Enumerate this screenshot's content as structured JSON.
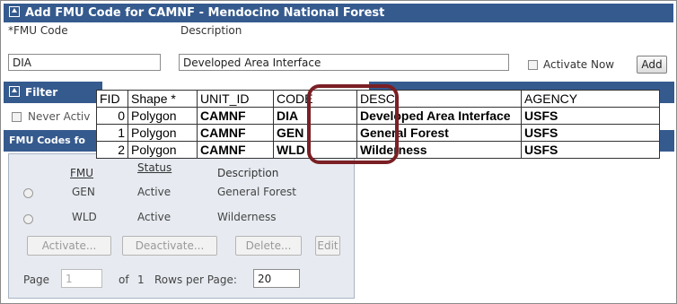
{
  "add_panel": {
    "title": "Add FMU Code for CAMNF - Mendocino National Forest",
    "fmu_code_label": "*FMU Code",
    "fmu_code_value": "DIA",
    "description_label": "Description",
    "description_value": "Developed Area Interface",
    "activate_now_label": "Activate Now",
    "add_label": "Add"
  },
  "filter_panel": {
    "title": "Filter",
    "never_active_label": "Never Activ"
  },
  "codes_panel": {
    "title": "FMU Codes fo",
    "columns": [
      "FMU",
      "Status",
      "Description"
    ],
    "rows": [
      {
        "code": "GEN",
        "status": "Active",
        "description": "General Forest"
      },
      {
        "code": "WLD",
        "status": "Active",
        "description": "Wilderness"
      }
    ],
    "buttons": {
      "activate": "Activate...",
      "deactivate": "Deactivate...",
      "delete": "Delete...",
      "edit": "Edit"
    },
    "pager": {
      "page_label": "Page",
      "page_value": "1",
      "of_label": "of",
      "total_pages": "1",
      "rows_label": "Rows per Page:",
      "rows_value": "20"
    }
  },
  "attribute_table": {
    "headers": [
      "FID",
      "Shape *",
      "UNIT_ID",
      "CODE",
      "DESC",
      "AGENCY"
    ],
    "rows": [
      [
        "0",
        "Polygon",
        "CAMNF",
        "DIA",
        "Developed Area Interface",
        "USFS"
      ],
      [
        "1",
        "Polygon",
        "CAMNF",
        "GEN",
        "General Forest",
        "USFS"
      ],
      [
        "2",
        "Polygon",
        "CAMNF",
        "WLD",
        "Wilderness",
        "USFS"
      ]
    ]
  },
  "colors": {
    "header_bg": "#355a8e",
    "highlight": "#7a1f24",
    "panel_bg": "#e7ebf1"
  }
}
